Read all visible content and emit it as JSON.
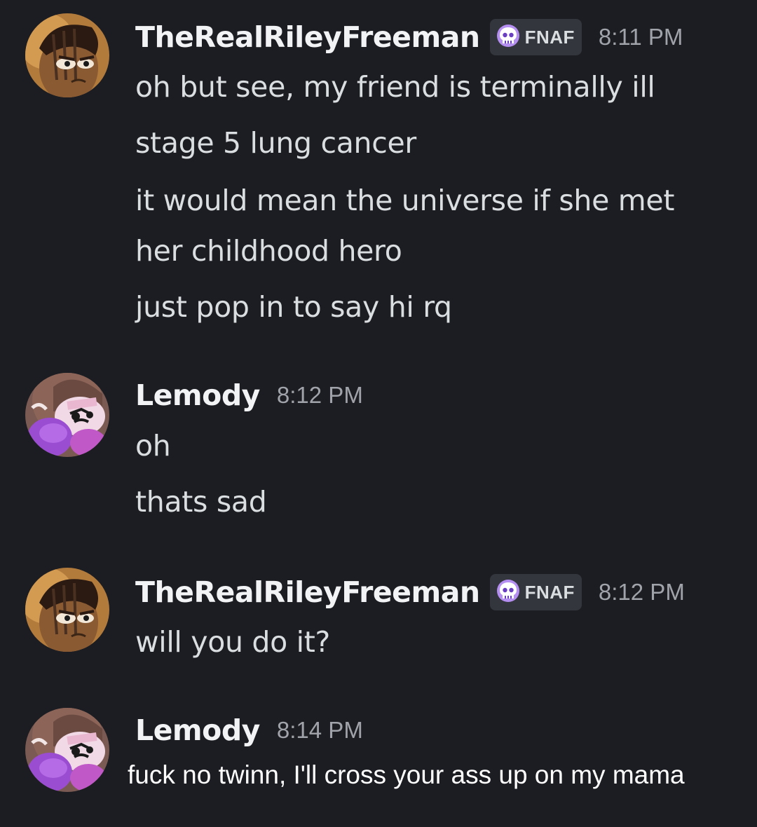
{
  "messages": [
    {
      "username": "TheRealRileyFreeman",
      "tag": {
        "label": "FNAF",
        "icon": "skull-icon"
      },
      "time": "8:11 PM",
      "lines": [
        "oh but see, my friend is terminally ill",
        "stage 5 lung cancer",
        "it would mean the universe if she met",
        "her childhood hero",
        "just pop in to say hi rq"
      ]
    },
    {
      "username": "Lemody",
      "time": "8:12 PM",
      "lines": [
        "oh",
        "thats sad"
      ]
    },
    {
      "username": "TheRealRileyFreeman",
      "tag": {
        "label": "FNAF",
        "icon": "skull-icon"
      },
      "time": "8:12 PM",
      "lines": [
        "will you do it?"
      ]
    },
    {
      "username": "Lemody",
      "time": "8:14 PM",
      "lines": [
        "fuck no twinn, I'll cross your ass up on my mama"
      ]
    }
  ],
  "colors": {
    "background": "#1c1d22",
    "username": "#f2f3f5",
    "text": "#dbdee1",
    "timestamp": "#a1a3aa",
    "tag_bg": "#34363d",
    "tag_icon": "#b48ef0"
  }
}
